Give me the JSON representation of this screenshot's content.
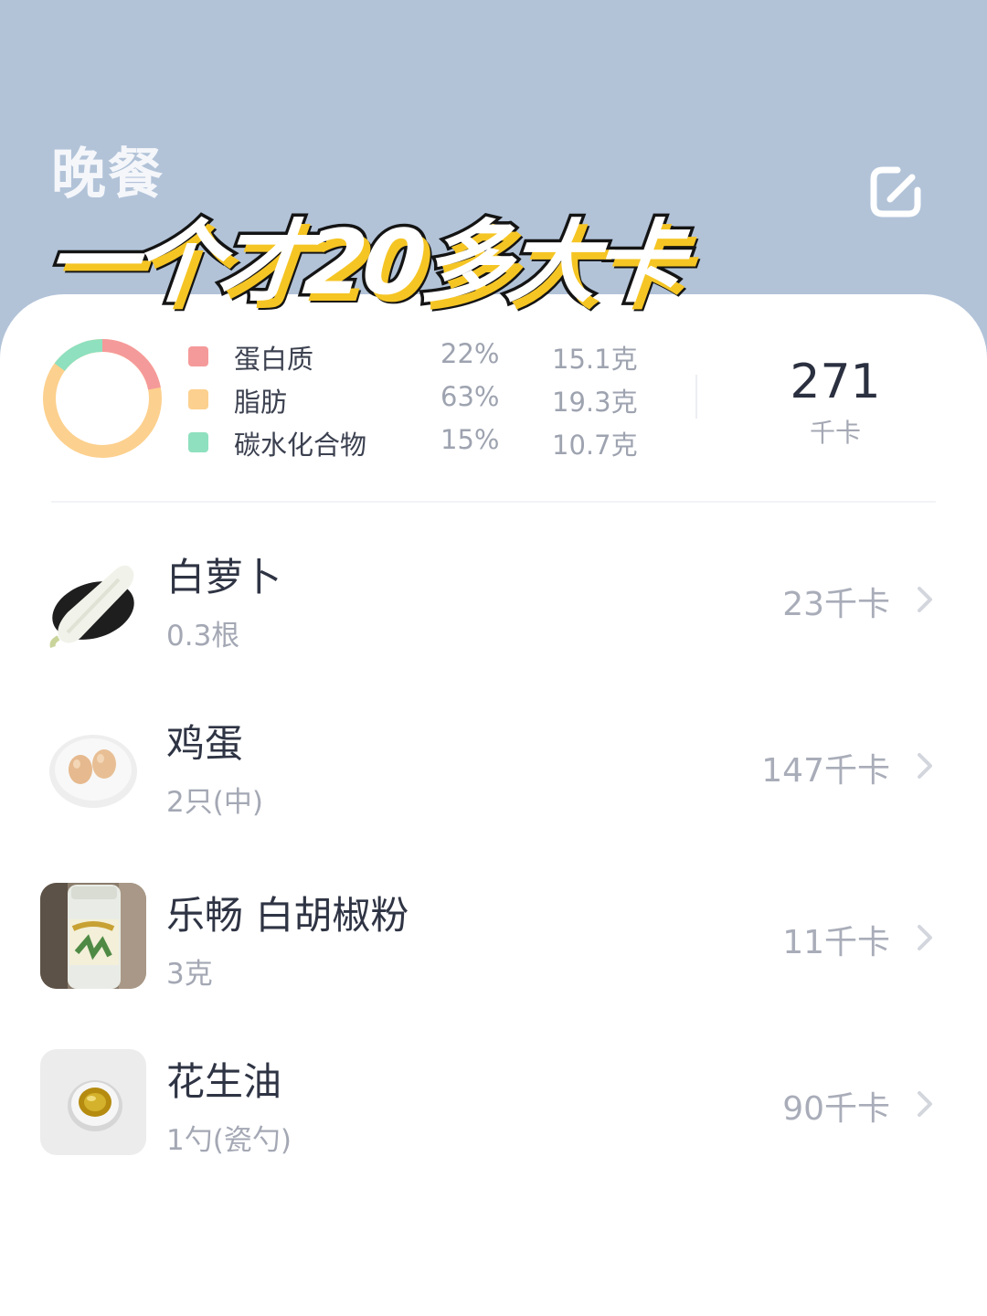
{
  "header": {
    "meal_title": "晚餐",
    "overlay_caption": "一个才20多大卡",
    "edit_icon": "edit-icon"
  },
  "summary": {
    "macros": [
      {
        "name": "蛋白质",
        "percent": "22%",
        "grams": "15.1克",
        "color": "#f59a9a"
      },
      {
        "name": "脂肪",
        "percent": "63%",
        "grams": "19.3克",
        "color": "#fcd08e"
      },
      {
        "name": "碳水化合物",
        "percent": "15%",
        "grams": "10.7克",
        "color": "#8ee0be"
      }
    ],
    "total_kcal": "271",
    "kcal_unit": "千卡"
  },
  "foods": [
    {
      "name": "白萝卜",
      "amount": "0.3根",
      "kcal": "23千卡",
      "thumb": "white-radish-image"
    },
    {
      "name": "鸡蛋",
      "amount": "2只(中)",
      "kcal": "147千卡",
      "thumb": "eggs-image"
    },
    {
      "name": "乐畅 白胡椒粉",
      "amount": "3克",
      "kcal": "11千卡",
      "thumb": "pepper-jar-image"
    },
    {
      "name": "花生油",
      "amount": "1勺(瓷勺)",
      "kcal": "90千卡",
      "thumb": "peanut-oil-image"
    }
  ],
  "colors": {
    "header_bg": "#b2c3d8",
    "caption_shadow": "#f5c524",
    "protein": "#f59a9a",
    "fat": "#fcd08e",
    "carb": "#8ee0be"
  }
}
